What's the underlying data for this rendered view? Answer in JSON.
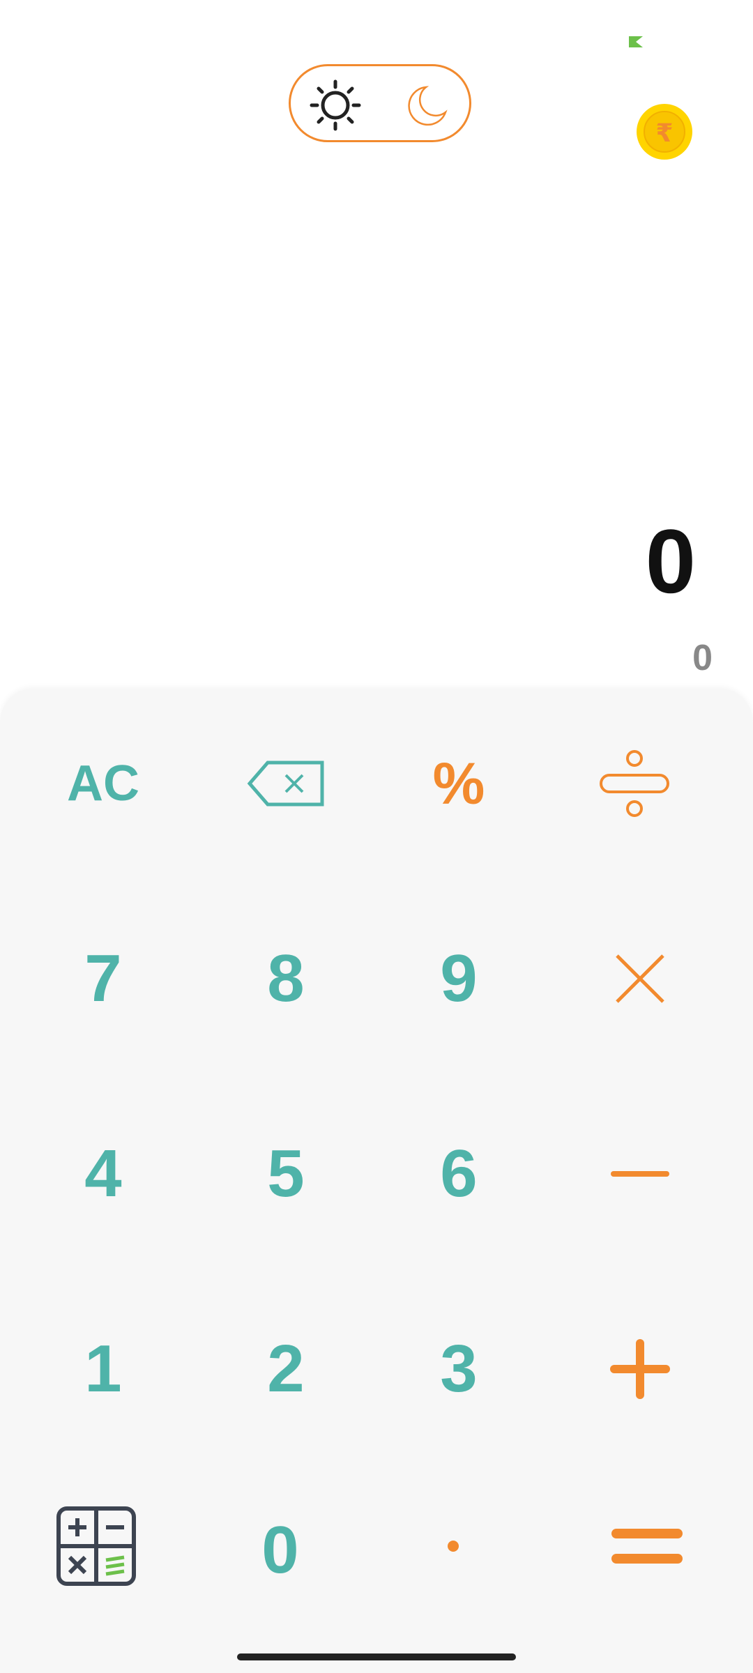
{
  "theme_toggle": {
    "light_icon": "sun-icon",
    "dark_icon": "moon-icon",
    "selected": "light"
  },
  "header": {
    "coin_icon": "rupee-coin-icon",
    "coin_symbol": "₹"
  },
  "display": {
    "main_value": "0",
    "sub_value": "0"
  },
  "keypad": {
    "clear_label": "AC",
    "backspace_icon": "backspace-icon",
    "percent_label": "%",
    "divide_icon": "divide-icon",
    "multiply_icon": "multiply-icon",
    "minus_icon": "minus-icon",
    "plus_icon": "plus-icon",
    "equals_icon": "equals-icon",
    "mode_icon": "calculator-mode-icon",
    "decimal_label": "·",
    "digits": {
      "d0": "0",
      "d1": "1",
      "d2": "2",
      "d3": "3",
      "d4": "4",
      "d5": "5",
      "d6": "6",
      "d7": "7",
      "d8": "8",
      "d9": "9"
    }
  },
  "colors": {
    "teal": "#4fb3a9",
    "orange": "#f28a2e",
    "coin": "#ffd400",
    "keypad_bg": "#f7f7f7"
  }
}
